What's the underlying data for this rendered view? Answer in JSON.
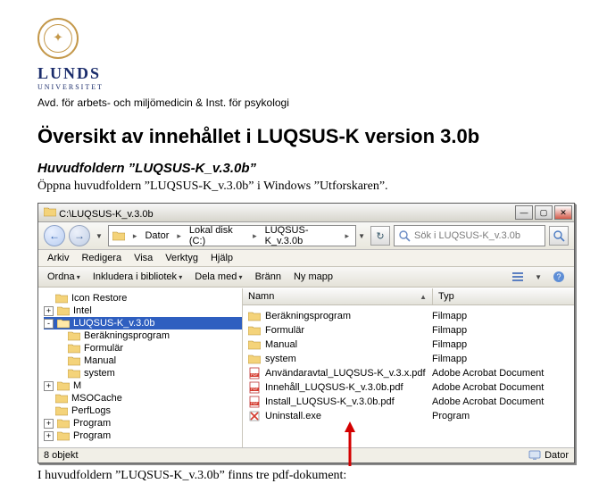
{
  "university": {
    "name": "LUNDS",
    "sub": "UNIVERSITET"
  },
  "department": "Avd. för arbets- och miljömedicin & Inst. för psykologi",
  "page_title": "Översikt av innehållet i LUQSUS-K version 3.0b",
  "section_title": "Huvudfoldern ”LUQSUS-K_v.3.0b”",
  "intro": "Öppna huvudfoldern ”LUQSUS-K_v.3.0b” i Windows ”Utforskaren”.",
  "outro": "I huvudfoldern ”LUQSUS-K_v.3.0b” finns tre pdf-dokument:",
  "explorer": {
    "title_path": "C:\\LUQSUS-K_v.3.0b",
    "breadcrumbs": [
      "Dator",
      "Lokal disk (C:)",
      "LUQSUS-K_v.3.0b"
    ],
    "search_placeholder": "Sök i LUQSUS-K_v.3.0b",
    "menus": {
      "file": "Arkiv",
      "edit": "Redigera",
      "view": "Visa",
      "tools": "Verktyg",
      "help": "Hjälp"
    },
    "commands": {
      "organize": "Ordna",
      "include": "Inkludera i bibliotek",
      "share": "Dela med",
      "burn": "Bränn",
      "newfolder": "Ny mapp"
    },
    "columns": {
      "name": "Namn",
      "type": "Typ"
    },
    "status": {
      "left": "8 objekt",
      "right": "Dator"
    },
    "tree": [
      {
        "level": 1,
        "tw": "",
        "icon": "folder",
        "label": "Icon Restore"
      },
      {
        "level": 1,
        "tw": "+",
        "icon": "folder",
        "label": "Intel"
      },
      {
        "level": 1,
        "tw": "-",
        "icon": "folder",
        "label": "LUQSUS-K_v.3.0b",
        "selected": true
      },
      {
        "level": 2,
        "tw": "",
        "icon": "folder",
        "label": "Beräkningsprogram"
      },
      {
        "level": 2,
        "tw": "",
        "icon": "folder",
        "label": "Formulär"
      },
      {
        "level": 2,
        "tw": "",
        "icon": "folder",
        "label": "Manual"
      },
      {
        "level": 2,
        "tw": "",
        "icon": "folder",
        "label": "system"
      },
      {
        "level": 1,
        "tw": "+",
        "icon": "folder",
        "label": "M"
      },
      {
        "level": 1,
        "tw": "",
        "icon": "folder",
        "label": "MSOCache"
      },
      {
        "level": 1,
        "tw": "",
        "icon": "folder",
        "label": "PerfLogs"
      },
      {
        "level": 1,
        "tw": "+",
        "icon": "folder",
        "label": "Program"
      },
      {
        "level": 1,
        "tw": "+",
        "icon": "folder",
        "label": "Program"
      }
    ],
    "files": [
      {
        "icon": "folder",
        "name": "Beräkningsprogram",
        "type": "Filmapp"
      },
      {
        "icon": "folder",
        "name": "Formulär",
        "type": "Filmapp"
      },
      {
        "icon": "folder",
        "name": "Manual",
        "type": "Filmapp"
      },
      {
        "icon": "folder",
        "name": "system",
        "type": "Filmapp"
      },
      {
        "icon": "pdf",
        "name": "Användaravtal_LUQSUS-K_v.3.x.pdf",
        "type": "Adobe Acrobat Document"
      },
      {
        "icon": "pdf",
        "name": "Innehåll_LUQSUS-K_v.3.0b.pdf",
        "type": "Adobe Acrobat Document"
      },
      {
        "icon": "pdf",
        "name": "Install_LUQSUS-K_v.3.0b.pdf",
        "type": "Adobe Acrobat Document"
      },
      {
        "icon": "exe",
        "name": "Uninstall.exe",
        "type": "Program"
      }
    ]
  }
}
